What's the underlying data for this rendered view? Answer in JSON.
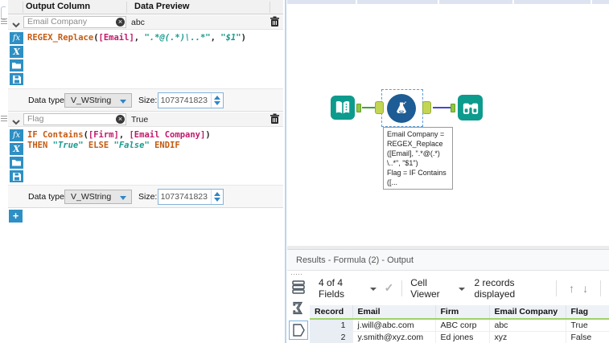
{
  "config": {
    "header": {
      "output_column": "Output Column",
      "data_preview": "Data Preview"
    },
    "labels": {
      "data_type": "Data type:",
      "size": "Size:"
    },
    "add_label": "+",
    "expressions": [
      {
        "name": "Email Company",
        "preview": "abc",
        "data_type": "V_WString",
        "size": "1073741823",
        "code": [
          [
            {
              "t": "fn",
              "v": "REGEX_Replace"
            },
            {
              "t": "p",
              "v": "("
            },
            {
              "t": "field",
              "v": "[Email]"
            },
            {
              "t": "p",
              "v": ", "
            },
            {
              "t": "str",
              "v": "\".*@(.*)\\..*\""
            },
            {
              "t": "p",
              "v": ", "
            },
            {
              "t": "str",
              "v": "\"$1\""
            },
            {
              "t": "p",
              "v": ")"
            }
          ]
        ]
      },
      {
        "name": "Flag",
        "preview": "True",
        "data_type": "V_WString",
        "size": "1073741823",
        "code": [
          [
            {
              "t": "fn",
              "v": "IF"
            },
            {
              "t": "p",
              "v": " "
            },
            {
              "t": "fn",
              "v": "Contains"
            },
            {
              "t": "p",
              "v": "("
            },
            {
              "t": "field",
              "v": "[Firm]"
            },
            {
              "t": "p",
              "v": ", "
            },
            {
              "t": "field",
              "v": "[Email Company]"
            },
            {
              "t": "p",
              "v": ")"
            }
          ],
          [
            {
              "t": "fn",
              "v": "THEN"
            },
            {
              "t": "p",
              "v": " "
            },
            {
              "t": "str",
              "v": "\"True\""
            },
            {
              "t": "p",
              "v": " "
            },
            {
              "t": "fn",
              "v": "ELSE"
            },
            {
              "t": "p",
              "v": " "
            },
            {
              "t": "str",
              "v": "\"False\""
            },
            {
              "t": "p",
              "v": " "
            },
            {
              "t": "fn",
              "v": "ENDIF"
            }
          ]
        ]
      }
    ]
  },
  "canvas": {
    "tooltip_lines": [
      "Email Company =",
      "REGEX_Replace",
      "([Email], \".*@(.*)",
      "\\..*\", \"$1\")",
      "Flag = IF Contains",
      "([..."
    ]
  },
  "results": {
    "title": "Results - Formula (2) - Output",
    "toolbar": {
      "fields": "4 of 4 Fields",
      "cell_viewer": "Cell Viewer",
      "records": "2 records displayed"
    },
    "table": {
      "columns": [
        "Record",
        "Email",
        "Firm",
        "Email Company",
        "Flag"
      ],
      "rows": [
        [
          "1",
          "j.will@abc.com",
          "ABC corp",
          "abc",
          "True"
        ],
        [
          "2",
          "y.smith@xyz.com",
          "Ed jones",
          "xyz",
          "False"
        ]
      ]
    }
  },
  "glyphs": {
    "clear": "×",
    "check": "✓",
    "up": "↑",
    "down": "↓",
    "fx": "fx",
    "x": "X"
  },
  "colors": {
    "accent_blue": "#2e8fc4",
    "tool_teal": "#0c9b8d",
    "formula_blue": "#1d5c94",
    "conn_green": "#44a03c",
    "conn_blue": "#4646d8",
    "header_green": "#9fd16a"
  }
}
